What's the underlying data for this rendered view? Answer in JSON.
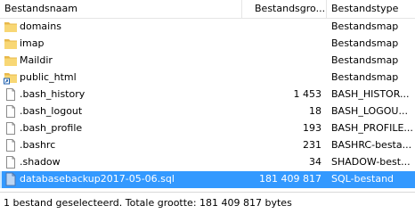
{
  "columns": {
    "name": "Bestandsnaam",
    "size": "Bestandsgro...",
    "type": "Bestandstype"
  },
  "files": [
    {
      "name": "domains",
      "size": "",
      "type": "Bestandsmap",
      "icon": "folder-icon"
    },
    {
      "name": "imap",
      "size": "",
      "type": "Bestandsmap",
      "icon": "folder-icon"
    },
    {
      "name": "Maildir",
      "size": "",
      "type": "Bestandsmap",
      "icon": "folder-icon"
    },
    {
      "name": "public_html",
      "size": "",
      "type": "Bestandsmap",
      "icon": "folder-shortcut-icon"
    },
    {
      "name": ".bash_history",
      "size": "1 453",
      "type": "BASH_HISTOR...",
      "icon": "file-icon"
    },
    {
      "name": ".bash_logout",
      "size": "18",
      "type": "BASH_LOGOU...",
      "icon": "file-icon"
    },
    {
      "name": ".bash_profile",
      "size": "193",
      "type": "BASH_PROFILE...",
      "icon": "file-icon"
    },
    {
      "name": ".bashrc",
      "size": "231",
      "type": "BASHRC-besta...",
      "icon": "file-icon"
    },
    {
      "name": ".shadow",
      "size": "34",
      "type": "SHADOW-best...",
      "icon": "file-icon"
    },
    {
      "name": "databasebackup2017-05-06.sql",
      "size": "181 409 817",
      "type": "SQL-bestand",
      "icon": "sql-file-icon",
      "selected": true
    }
  ],
  "status": {
    "text": "1 bestand geselecteerd. Totale grootte: 181 409 817 bytes"
  },
  "colors": {
    "folder": "#f8d775",
    "selection": "#3399ff"
  }
}
